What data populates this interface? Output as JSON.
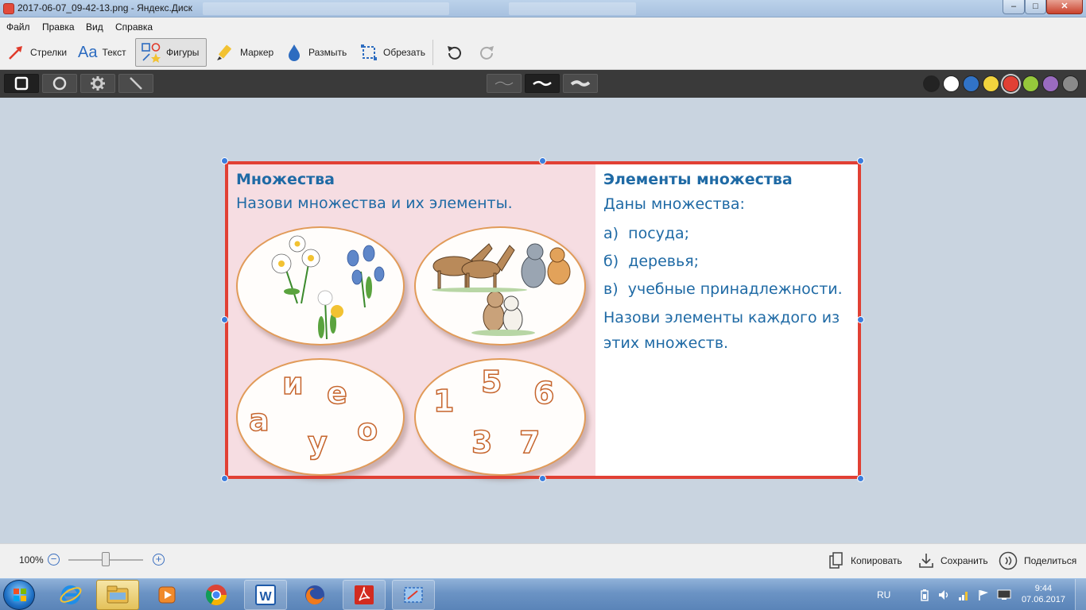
{
  "window": {
    "title": "2017-06-07_09-42-13.png - Яндекс.Диск",
    "controls": {
      "minimize": "–",
      "maximize": "□",
      "close": "✕"
    }
  },
  "menu": [
    "Файл",
    "Правка",
    "Вид",
    "Справка"
  ],
  "toolbar": {
    "arrows": "Стрелки",
    "text": "Текст",
    "text_icon": "Aa",
    "shapes": "Фигуры",
    "marker": "Маркер",
    "blur": "Размыть",
    "crop": "Обрезать",
    "active_tool": "Фигуры"
  },
  "palette": [
    "#232323",
    "#ffffff",
    "#3173c6",
    "#f1d33d",
    "#e14034",
    "#96c83b",
    "#9a6bc0",
    "#8a8a8a"
  ],
  "selected_color": "#e14034",
  "document": {
    "left_title": "Множества",
    "left_subtitle": "Назови множества и их элементы.",
    "right_title": "Элементы множества",
    "right_intro": "Даны множества:",
    "items": [
      {
        "marker": "а)",
        "text": "посуда;"
      },
      {
        "marker": "б)",
        "text": "деревья;"
      },
      {
        "marker": "в)",
        "text": "учебные принадлежности."
      }
    ],
    "task_line1": "Назови элементы каждого из",
    "task_line2": "этих множеств.",
    "letters": [
      "и",
      "е",
      "а",
      "о",
      "у"
    ],
    "digits": [
      "5",
      "1",
      "6",
      "3",
      "7"
    ]
  },
  "statusbar": {
    "zoom": "100%",
    "zoom_level": 1.0,
    "copy": "Копировать",
    "save": "Сохранить",
    "share": "Поделиться"
  },
  "taskbar": {
    "language": "RU",
    "time": "9:44",
    "date": "07.06.2017",
    "apps": [
      "explorer",
      "internet-explorer",
      "media-player",
      "chrome",
      "word",
      "firefox",
      "acrobat",
      "yandex-screenshot"
    ],
    "word_glyph": "W"
  }
}
